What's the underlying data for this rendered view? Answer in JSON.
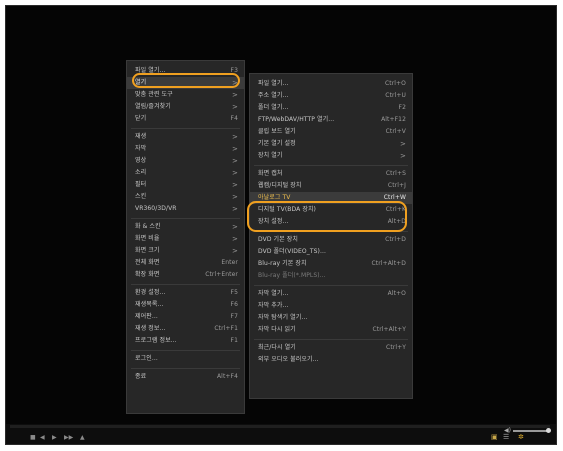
{
  "main_menu": {
    "items": [
      {
        "label": "파일 열기...",
        "shortcut": "F3"
      },
      {
        "label": "열기",
        "arrow": ">"
      },
      {
        "label": "맞춤 관련 도구",
        "arrow": ">"
      },
      {
        "label": "열림/즐겨찾기",
        "arrow": ">"
      },
      {
        "label": "닫기",
        "shortcut": "F4"
      },
      {
        "label": "재생",
        "arrow": ">"
      },
      {
        "label": "자막",
        "arrow": ">"
      },
      {
        "label": "영상",
        "arrow": ">"
      },
      {
        "label": "소리",
        "arrow": ">"
      },
      {
        "label": "필터",
        "arrow": ">"
      },
      {
        "label": "스킨",
        "arrow": ">"
      },
      {
        "label": "VR360/3D/VR",
        "arrow": ">"
      },
      {
        "label": "화 & 스킨",
        "arrow": ">"
      },
      {
        "label": "화면 비율",
        "arrow": ">"
      },
      {
        "label": "화면 크기",
        "arrow": ">"
      },
      {
        "label": "전체 화면",
        "shortcut": "Enter"
      },
      {
        "label": "확장 화면",
        "shortcut": "Ctrl+Enter"
      },
      {
        "label": "환경 설정...",
        "shortcut": "F5"
      },
      {
        "label": "재생목록...",
        "shortcut": "F6"
      },
      {
        "label": "제어판...",
        "shortcut": "F7"
      },
      {
        "label": "재생 정보...",
        "shortcut": "Ctrl+F1"
      },
      {
        "label": "프로그램 정보...",
        "shortcut": "F1"
      },
      {
        "label": "로그인..."
      },
      {
        "label": "종료",
        "shortcut": "Alt+F4"
      }
    ]
  },
  "sub_menu": {
    "items": [
      {
        "label": "파일 열기...",
        "shortcut": "Ctrl+O"
      },
      {
        "label": "주소 열기...",
        "shortcut": "Ctrl+U"
      },
      {
        "label": "폴더 열기...",
        "shortcut": "F2"
      },
      {
        "label": "FTP/WebDAV/HTTP 열기...",
        "shortcut": "Alt+F12"
      },
      {
        "label": "클립 보드 열기",
        "shortcut": "Ctrl+V"
      },
      {
        "label": "기본 열기 설정",
        "arrow": ">"
      },
      {
        "label": "장치 열기",
        "arrow": ">"
      },
      {
        "label": "화면 캡처",
        "shortcut": "Ctrl+S"
      },
      {
        "label": "웹캠/디지털 장치",
        "shortcut": "Ctrl+J"
      },
      {
        "label": "아날로그 TV",
        "shortcut": "Ctrl+W"
      },
      {
        "label": "디지털 TV(BDA 장치)",
        "shortcut": "Ctrl+K"
      },
      {
        "label": "장치 설정...",
        "shortcut": "Alt+D"
      },
      {
        "label": "DVD 기본 장치",
        "shortcut": "Ctrl+D"
      },
      {
        "label": "DVD 폴더(VIDEO_TS)..."
      },
      {
        "label": "Blu-ray 기본 장치",
        "shortcut": "Ctrl+Alt+D"
      },
      {
        "label": "Blu-ray 폴더(*.MPLS)..."
      },
      {
        "label": "자막 열기...",
        "shortcut": "Alt+O"
      },
      {
        "label": "자막 추가..."
      },
      {
        "label": "자막 탐색기 열기..."
      },
      {
        "label": "자막 다시 읽기",
        "shortcut": "Ctrl+Alt+Y"
      },
      {
        "label": "최근/다시 열기",
        "shortcut": "Ctrl+Y"
      },
      {
        "label": "외부 오디오 불러오기..."
      }
    ]
  },
  "player": {
    "volume_level": 1.0,
    "volume_icon": "speaker-icon",
    "left_controls": [
      "stop-icon",
      "prev-icon",
      "play-icon",
      "next-icon",
      "open-icon"
    ],
    "right_controls": [
      "subtitle-icon",
      "playlist-icon",
      "settings-icon"
    ]
  },
  "colors": {
    "accent_ring": "#f0a020",
    "highlight_text": "#f2c14e",
    "menu_bg": "#272727"
  }
}
